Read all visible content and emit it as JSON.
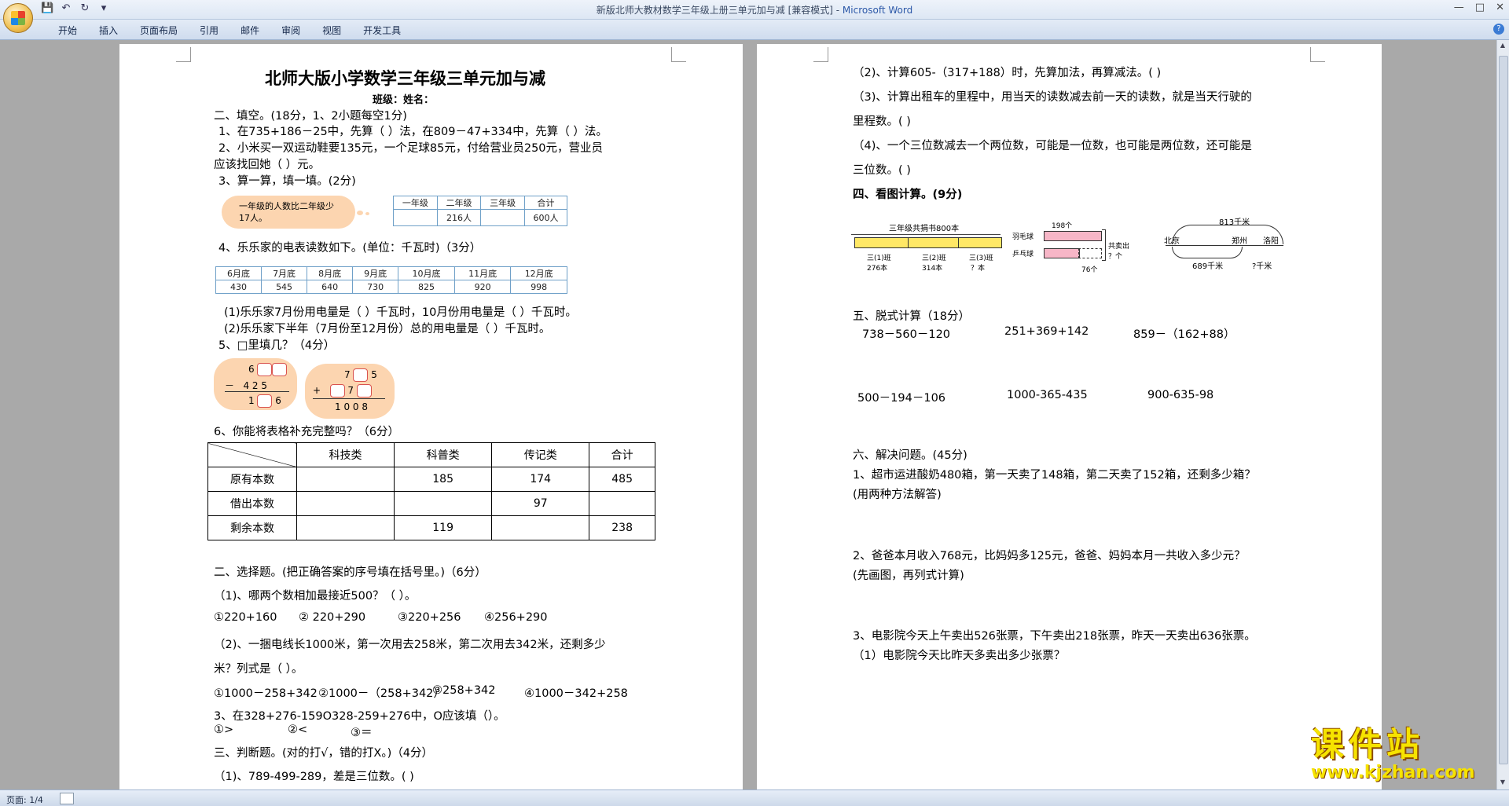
{
  "window": {
    "title_doc": "新版北师大教材数学三年级上册三单元加与减 [兼容模式] - ",
    "title_app": "Microsoft Word"
  },
  "ribbon": {
    "tabs": [
      "开始",
      "插入",
      "页面布局",
      "引用",
      "邮件",
      "审阅",
      "视图",
      "开发工具"
    ]
  },
  "status": {
    "page": "页面: 1/4"
  },
  "watermark": {
    "brand": "课件站",
    "url": "www.kjzhan.com"
  },
  "page1": {
    "title": "北师大版小学数学三年级三单元加与减",
    "class_line": "班级：姓名：",
    "s2_head": "二、填空。(18分，1、2小题每空1分)",
    "q1": "1、在735+186－25中，先算（    ）法，在809－47+334中，先算（    ）法。",
    "q2a": "2、小米买一双运动鞋要135元，一个足球85元，付给营业员250元，营业员",
    "q2b": "应该找回她（    ）元。",
    "q3": "3、算一算，填一填。(2分)",
    "q3_cloud": "一年级的人数比二年级少17人。",
    "q3_table": {
      "head": [
        "一年级",
        "二年级",
        "三年级",
        "合计"
      ],
      "row": [
        "",
        "216人",
        "",
        "600人"
      ]
    },
    "q4": "4、乐乐家的电表读数如下。(单位：千瓦时)（3分）",
    "q4_table": {
      "head": [
        "6月底",
        "7月底",
        "8月底",
        "9月底",
        "10月底",
        "11月底",
        "12月底"
      ],
      "row": [
        "430",
        "545",
        "640",
        "730",
        "825",
        "920",
        "998"
      ]
    },
    "q4_1": "(1)乐乐家7月份用电量是（   ）千瓦时，10月份用电量是（   ）千瓦时。",
    "q4_2": "(2)乐乐家下半年（7月份至12月份）总的用电量是（      ）千瓦时。",
    "q5": "5、□里填几？（4分）",
    "q5_a": {
      "r1": "6",
      "op": "－",
      "r2": "4 2 5",
      "r3a": "1",
      "r3b": "6"
    },
    "q5_b": {
      "r1a": "7",
      "r1b": "5",
      "op": "+",
      "r2": "7",
      "r3": "1 0 0 8"
    },
    "q6": "6、你能将表格补充完整吗？（6分）",
    "q6_table": {
      "head": [
        "",
        "科技类",
        "科普类",
        "传记类",
        "合计"
      ],
      "rows": [
        [
          "原有本数",
          "",
          "185",
          "174",
          "485"
        ],
        [
          "借出本数",
          "",
          "",
          "97",
          ""
        ],
        [
          "剩余本数",
          "",
          "119",
          "",
          "238"
        ]
      ]
    },
    "s_choice": "二、选择题。(把正确答案的序号填在括号里。)（6分）",
    "c1": "（1)、哪两个数相加最接近500？（        ）。",
    "c1_opts": [
      "①220+160",
      "②  220+290",
      "③220+256",
      "④256+290"
    ],
    "c2a": "（2)、一捆电线长1000米，第一次用去258米，第二次用去342米，还剩多少",
    "c2b": "米？列式是（        ）。",
    "c2_opts": [
      "①1000－258+342",
      "②1000－（258+342）",
      "③258+342",
      "④1000－342+258"
    ],
    "c3": "3、在328+276-159O328-259+276中，O应该填（）。",
    "c3_opts": [
      "①>",
      "②<",
      "③＝"
    ],
    "s_judge": "三、判断题。(对的打√，错的打X。)（4分）",
    "j1": "（1)、789-499-289，差是三位数。(       )"
  },
  "page2": {
    "j2": "（2)、计算605-（317+188）时，先算加法，再算减法。(       )",
    "j3a": "（3)、计算出租车的里程中，用当天的读数减去前一天的读数，就是当天行驶的",
    "j3b": "里程数。(       )",
    "j4a": "（4)、一个三位数减去一个两位数，可能是一位数，也可能是两位数，还可能是",
    "j4b": "三位数。(       )",
    "s4": "四、看图计算。(9分)",
    "fig1": {
      "top": "三年级共捐书800本",
      "l1": "三(1)班",
      "v1": "276本",
      "l2": "三(2)班",
      "v2": "314本",
      "l3": "三(3)班",
      "v3": "？本"
    },
    "fig2": {
      "a": "羽毛球",
      "av": "198个",
      "b": "乒乓球",
      "sum": "共卖出 ？个",
      "diff": "76个"
    },
    "fig3": {
      "top": "813千米",
      "c1": "北京",
      "c2": "郑州",
      "c3": "洛阳",
      "d1": "689千米",
      "d2": "?千米"
    },
    "s5": "五、脱式计算（18分）",
    "e1": "738－560－120",
    "e2": "251+369+142",
    "e3": "859－（162+88）",
    "e4": "500－194－106",
    "e5": "1000-365-435",
    "e6": "900-635-98",
    "s6": "六、解决问题。(45分)",
    "p1a": "1、超市运进酸奶480箱，第一天卖了148箱，第二天卖了152箱，还剩多少箱？",
    "p1b": "(用两种方法解答)",
    "p2a": "2、爸爸本月收入768元，比妈妈多125元，爸爸、妈妈本月一共收入多少元？",
    "p2b": "(先画图，再列式计算)",
    "p3a": "3、电影院今天上午卖出526张票，下午卖出218张票，昨天一天卖出636张票。",
    "p3b": "（1）电影院今天比昨天多卖出多少张票？"
  }
}
